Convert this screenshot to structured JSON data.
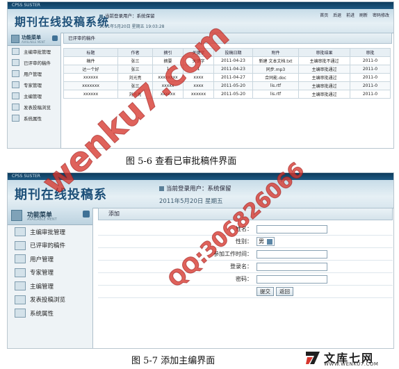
{
  "screen1": {
    "app_title": "期刊在线投稿系统",
    "topstrip": "CPSS SUSTER",
    "user_line": "当前登录用户：系统保留",
    "date_line": "2011年5月20日 星期五 19:03:28",
    "top_links": [
      "首页",
      "后退",
      "前进",
      "刷新",
      "密码修改"
    ],
    "sidebar": {
      "title": "功能菜单",
      "subtitle": "AVAILABLE MENT",
      "items": [
        "主编审批管理",
        "已评审的稿件",
        "用户管理",
        "专家管理",
        "主编管理",
        "发表投稿浏览",
        "系统属性"
      ]
    },
    "tab_label": "已评审的稿件",
    "table": {
      "headers": [
        "标题",
        "作者",
        "摘引",
        "关键字",
        "投稿日期",
        "附件",
        "审批结果",
        "审批"
      ],
      "rows": [
        [
          "稿件",
          "张三",
          "摘要",
          "关键字",
          "2011-04-23",
          "新建 文本文档.txt",
          "主编审批不通过",
          "2011-0"
        ],
        [
          "达一个好",
          "张三",
          "1",
          "1",
          "2011-04-23",
          "同步.mp3",
          "主编审批通过",
          "2011-0"
        ],
        [
          "xxxxxx",
          "刘光亮",
          "xxxxxxxx",
          "xxxx",
          "2011-04-27",
          "合同能.doc",
          "主编审批通过",
          "2011-0"
        ],
        [
          "xxxxxxx",
          "张三",
          "xxxxx",
          "xxxx",
          "2011-05-20",
          "lis.rtf",
          "主编审批通过",
          "2011-0"
        ],
        [
          "xxxxxx",
          "刘光亮",
          "xxxxxx",
          "xxxxxx",
          "2011-05-20",
          "lis.rtf",
          "主编审批通过",
          "2011-0"
        ]
      ]
    }
  },
  "caption1": "图 5-6 查看已审批稿件界面",
  "screen2": {
    "app_title": "期刊在线投稿系",
    "topstrip": "CPSS SUSTER",
    "user_line": "当前登录用户：系统保留",
    "date_line": "2011年5月20日 星期五",
    "sidebar": {
      "title": "功能菜单",
      "subtitle": "AVAILABLE MENT",
      "items": [
        "主编审批管理",
        "已评审的稿件",
        "用户管理",
        "专家管理",
        "主编管理",
        "发表投稿浏览",
        "系统属性"
      ]
    },
    "tab_label": "添加",
    "form": {
      "name_label": "姓名：",
      "gender_label": "性别：",
      "gender_value": "男",
      "work_time_label": "参加工作时间：",
      "login_label": "登录名：",
      "password_label": "密码：",
      "submit_label": "提交",
      "back_label": "返回"
    }
  },
  "caption2": "图 5-7 添加主编界面",
  "watermarks": {
    "site": "wenku7.com",
    "qq": "QQ:306826066"
  },
  "brand": {
    "name": "文库七网",
    "url": "WWW.WENKU7.COM"
  },
  "colors": {
    "header_dark": "#1e5a83",
    "watermark": "#d6362d",
    "title_blue": "#1c4f78"
  }
}
